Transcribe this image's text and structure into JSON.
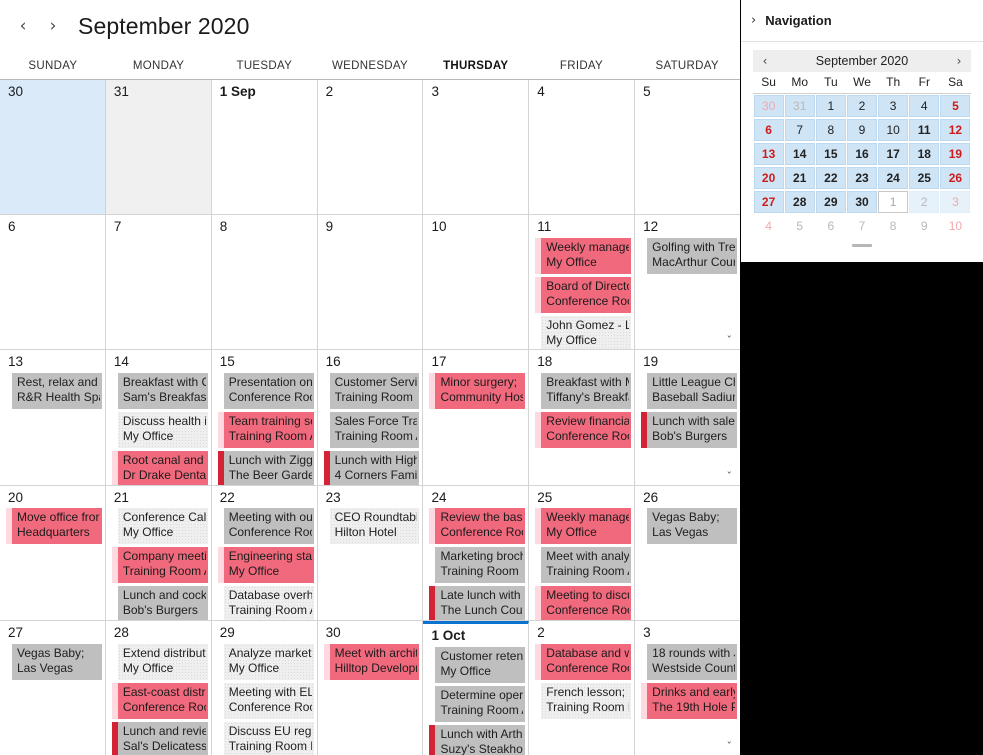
{
  "calendar": {
    "title": "September 2020",
    "prev_label": "‹",
    "next_label": "›",
    "day_headers": [
      "SUNDAY",
      "MONDAY",
      "TUESDAY",
      "WEDNESDAY",
      "THURSDAY",
      "FRIDAY",
      "SATURDAY"
    ],
    "today_dow_index": 4,
    "more_chevron": "ˇ",
    "weeks": [
      {
        "days": [
          {
            "num": "30",
            "style": "selected",
            "events": []
          },
          {
            "num": "31",
            "style": "othermonth",
            "events": []
          },
          {
            "num": "1 Sep",
            "bold": true,
            "events": []
          },
          {
            "num": "2",
            "events": []
          },
          {
            "num": "3",
            "events": []
          },
          {
            "num": "4",
            "events": []
          },
          {
            "num": "5",
            "events": []
          }
        ]
      },
      {
        "days": [
          {
            "num": "6",
            "events": []
          },
          {
            "num": "7",
            "events": []
          },
          {
            "num": "8",
            "events": []
          },
          {
            "num": "9",
            "events": []
          },
          {
            "num": "10",
            "events": []
          },
          {
            "num": "11",
            "events": [
              {
                "title": "Weekly manage",
                "location": "My Office",
                "cat": "pink"
              },
              {
                "title": "Board of Directo",
                "location": "Conference Roo",
                "cat": "pink"
              },
              {
                "title": "John Gomez - Ll",
                "location": "My Office",
                "cat": "light"
              }
            ]
          },
          {
            "num": "12",
            "more": true,
            "events": [
              {
                "title": "Golfing with Tre",
                "location": "MacArthur Cour",
                "cat": "grey"
              }
            ]
          }
        ]
      },
      {
        "days": [
          {
            "num": "13",
            "events": [
              {
                "title": "Rest, relax and g",
                "location": "R&R Health Spa",
                "cat": "grey"
              }
            ]
          },
          {
            "num": "14",
            "events": [
              {
                "title": "Breakfast with C",
                "location": "Sam's Breakfast",
                "cat": "grey"
              },
              {
                "title": "Discuss health in",
                "location": "My Office",
                "cat": "light"
              },
              {
                "title": "Root canal and t",
                "location": "Dr Drake Dental",
                "cat": "pink"
              }
            ]
          },
          {
            "num": "15",
            "events": [
              {
                "title": "Presentation on",
                "location": "Conference Roo",
                "cat": "grey"
              },
              {
                "title": "Team training se",
                "location": "Training Room A",
                "cat": "pink"
              },
              {
                "title": "Lunch with Zigg",
                "location": "The Beer Garder",
                "cat": "greyred"
              }
            ]
          },
          {
            "num": "16",
            "events": [
              {
                "title": "Customer Servic",
                "location": "Training Room B",
                "cat": "grey"
              },
              {
                "title": "Sales Force Trair",
                "location": "Training Room A",
                "cat": "grey"
              },
              {
                "title": "Lunch with High",
                "location": "4 Corners Family",
                "cat": "greyred"
              }
            ]
          },
          {
            "num": "17",
            "events": [
              {
                "title": "Minor surgery;",
                "location": "Community Hos",
                "cat": "pink"
              }
            ]
          },
          {
            "num": "18",
            "events": [
              {
                "title": "Breakfast with M",
                "location": "Tiffany's Breakfa",
                "cat": "grey"
              },
              {
                "title": "Review financial",
                "location": "Conference Roo",
                "cat": "pink"
              }
            ]
          },
          {
            "num": "19",
            "more": true,
            "events": [
              {
                "title": "Little League Ch",
                "location": "Baseball Sadium",
                "cat": "grey"
              },
              {
                "title": "Lunch with sales",
                "location": "Bob's Burgers",
                "cat": "greyred"
              }
            ]
          }
        ]
      },
      {
        "days": [
          {
            "num": "20",
            "events": [
              {
                "title": "Move office fror",
                "location": "Headquarters",
                "cat": "pink"
              }
            ]
          },
          {
            "num": "21",
            "events": [
              {
                "title": "Conference Call",
                "location": "My Office",
                "cat": "light"
              },
              {
                "title": "Company meetii",
                "location": "Training Room A",
                "cat": "pink"
              },
              {
                "title": "Lunch and cockt",
                "location": "Bob's Burgers",
                "cat": "grey"
              }
            ]
          },
          {
            "num": "22",
            "events": [
              {
                "title": "Meeting with ou",
                "location": "Conference Roo",
                "cat": "grey"
              },
              {
                "title": "Engineering staf",
                "location": "My Office",
                "cat": "pink"
              },
              {
                "title": "Database overha",
                "location": "Training Room A",
                "cat": "light"
              }
            ]
          },
          {
            "num": "23",
            "events": [
              {
                "title": "CEO Roundtable",
                "location": "Hilton Hotel",
                "cat": "light"
              }
            ]
          },
          {
            "num": "24",
            "events": [
              {
                "title": "Review the basic",
                "location": "Conference Roo",
                "cat": "pink"
              },
              {
                "title": "Marketing broch",
                "location": "Training Room B",
                "cat": "grey"
              },
              {
                "title": "Late lunch with I",
                "location": "The Lunch Coun",
                "cat": "greyred"
              }
            ]
          },
          {
            "num": "25",
            "more": true,
            "events": [
              {
                "title": "Weekly manage",
                "location": "My Office",
                "cat": "pink"
              },
              {
                "title": "Meet with analy:",
                "location": "Training Room A",
                "cat": "grey"
              },
              {
                "title": "Meeting to discu",
                "location": "Conference Roo",
                "cat": "pink"
              }
            ]
          },
          {
            "num": "26",
            "events": [
              {
                "title": "Vegas Baby;",
                "location": "Las Vegas",
                "cat": "grey"
              }
            ]
          }
        ]
      },
      {
        "days": [
          {
            "num": "27",
            "events": [
              {
                "title": "Vegas Baby;",
                "location": "Las Vegas",
                "cat": "grey"
              }
            ]
          },
          {
            "num": "28",
            "events": [
              {
                "title": "Extend distributi",
                "location": "My Office",
                "cat": "light"
              },
              {
                "title": "East-coast distril",
                "location": "Conference Roo",
                "cat": "pink"
              },
              {
                "title": "Lunch and revieˇ",
                "location": "Sal's Delicatesse",
                "cat": "greyred"
              }
            ]
          },
          {
            "num": "29",
            "events": [
              {
                "title": "Analyze market",
                "location": "My Office",
                "cat": "light"
              },
              {
                "title": "Meeting with EL",
                "location": "Conference Roo",
                "cat": "light"
              },
              {
                "title": "Discuss EU regu",
                "location": "Training Room B",
                "cat": "light"
              }
            ]
          },
          {
            "num": "30",
            "events": [
              {
                "title": "Meet with archit",
                "location": "Hilltop Developr",
                "cat": "pink"
              }
            ]
          },
          {
            "num": "1 Oct",
            "bold": true,
            "today": true,
            "events": [
              {
                "title": "Customer retent",
                "location": "My Office",
                "cat": "grey"
              },
              {
                "title": "Determine opera",
                "location": "Training Room A",
                "cat": "grey"
              },
              {
                "title": "Lunch with Arthu",
                "location": "Suzy's Steakhou",
                "cat": "greyred"
              }
            ]
          },
          {
            "num": "2",
            "events": [
              {
                "title": "Database and w",
                "location": "Conference Roo",
                "cat": "pink"
              },
              {
                "title": "French lesson;",
                "location": "Training Room B",
                "cat": "light"
              }
            ]
          },
          {
            "num": "3",
            "more": true,
            "events": [
              {
                "title": "18 rounds with J",
                "location": "Westside Countr",
                "cat": "grey"
              },
              {
                "title": "Drinks and early",
                "location": "The 19th Hole Pˇ",
                "cat": "pink"
              }
            ]
          }
        ]
      }
    ]
  },
  "navigation": {
    "panel_title": "Navigation",
    "expand_chevron": "›",
    "mini": {
      "title": "September 2020",
      "prev_label": "‹",
      "next_label": "›",
      "dows": [
        "Su",
        "Mo",
        "Tu",
        "We",
        "Th",
        "Fr",
        "Sa"
      ],
      "weeks": [
        [
          {
            "n": "30",
            "cls": "inrange dimwknd"
          },
          {
            "n": "31",
            "cls": "inrange dim"
          },
          {
            "n": "1",
            "cls": "inrange"
          },
          {
            "n": "2",
            "cls": "inrange"
          },
          {
            "n": "3",
            "cls": "inrange"
          },
          {
            "n": "4",
            "cls": "inrange"
          },
          {
            "n": "5",
            "cls": "inrange wknd bold"
          }
        ],
        [
          {
            "n": "6",
            "cls": "inrange wknd bold"
          },
          {
            "n": "7",
            "cls": "inrange"
          },
          {
            "n": "8",
            "cls": "inrange"
          },
          {
            "n": "9",
            "cls": "inrange"
          },
          {
            "n": "10",
            "cls": "inrange"
          },
          {
            "n": "11",
            "cls": "inrange bold"
          },
          {
            "n": "12",
            "cls": "inrange wknd bold"
          }
        ],
        [
          {
            "n": "13",
            "cls": "inrange wknd bold"
          },
          {
            "n": "14",
            "cls": "inrange bold"
          },
          {
            "n": "15",
            "cls": "inrange bold"
          },
          {
            "n": "16",
            "cls": "inrange bold"
          },
          {
            "n": "17",
            "cls": "inrange bold"
          },
          {
            "n": "18",
            "cls": "inrange bold"
          },
          {
            "n": "19",
            "cls": "inrange wknd bold"
          }
        ],
        [
          {
            "n": "20",
            "cls": "inrange wknd bold"
          },
          {
            "n": "21",
            "cls": "inrange bold"
          },
          {
            "n": "22",
            "cls": "inrange bold"
          },
          {
            "n": "23",
            "cls": "inrange bold"
          },
          {
            "n": "24",
            "cls": "inrange bold"
          },
          {
            "n": "25",
            "cls": "inrange bold"
          },
          {
            "n": "26",
            "cls": "inrange wknd bold"
          }
        ],
        [
          {
            "n": "27",
            "cls": "inrange wknd bold"
          },
          {
            "n": "28",
            "cls": "inrange bold"
          },
          {
            "n": "29",
            "cls": "inrange bold"
          },
          {
            "n": "30",
            "cls": "inrange bold"
          },
          {
            "n": "1",
            "cls": "todaybox"
          },
          {
            "n": "2",
            "cls": "softrange dim"
          },
          {
            "n": "3",
            "cls": "softrange dimwknd"
          }
        ],
        [
          {
            "n": "4",
            "cls": "dimwknd"
          },
          {
            "n": "5",
            "cls": "dim"
          },
          {
            "n": "6",
            "cls": "dim"
          },
          {
            "n": "7",
            "cls": "dim"
          },
          {
            "n": "8",
            "cls": "dim"
          },
          {
            "n": "9",
            "cls": "dim"
          },
          {
            "n": "10",
            "cls": "dimwknd"
          }
        ]
      ]
    }
  },
  "colors": {
    "accent_blue": "#0a72cf",
    "selected_cell": "#dbeaf8",
    "event_pink": "#f1697d",
    "event_grey": "#bfbfbf",
    "event_light": "#efefef",
    "category_red_bar": "#d32436",
    "mini_range": "#cfe4f5",
    "weekend_red": "#d01b1b"
  }
}
